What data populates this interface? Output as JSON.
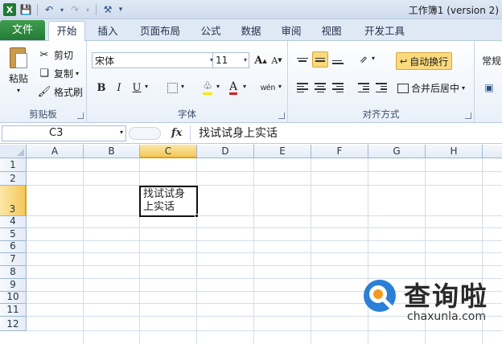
{
  "window": {
    "title": "工作簿1 (version 2)"
  },
  "quick_access": {
    "icons": [
      "excel-icon",
      "save-icon",
      "undo-icon",
      "redo-icon",
      "customize-icon"
    ]
  },
  "tabs": {
    "file": "文件",
    "items": [
      "开始",
      "插入",
      "页面布局",
      "公式",
      "数据",
      "审阅",
      "视图",
      "开发工具"
    ],
    "active": "开始"
  },
  "ribbon": {
    "clipboard": {
      "label": "剪贴板",
      "paste": "粘贴",
      "cut": "剪切",
      "copy": "复制",
      "format_painter": "格式刷"
    },
    "font": {
      "label": "字体",
      "font_name": "宋体",
      "font_size": "11",
      "bold": "B",
      "italic": "I",
      "underline": "U",
      "grow": "A",
      "shrink": "A",
      "phonetic": "wén"
    },
    "alignment": {
      "label": "对齐方式",
      "wrap_text": "自动换行",
      "merge_center": "合并后居中"
    },
    "number": {
      "format": "常规"
    }
  },
  "formula_bar": {
    "name_box": "C3",
    "fx": "fx",
    "content": "找试试身上实话"
  },
  "grid": {
    "columns": [
      "A",
      "B",
      "C",
      "D",
      "E",
      "F",
      "G",
      "H"
    ],
    "rows": [
      "1",
      "2",
      "3",
      "4",
      "5",
      "6",
      "7",
      "8",
      "9",
      "10",
      "11",
      "12"
    ],
    "selected_column": "C",
    "selected_row": "3",
    "active_cell": {
      "ref": "C3",
      "line1": "找试试身",
      "line2": "上实话"
    }
  },
  "watermark": {
    "brand": "查询啦",
    "url": "chaxunla.com"
  },
  "colors": {
    "file_tab": "#2e8b3f",
    "selection": "#f4c85b",
    "header_bg": "#e4ecf7",
    "gridline": "#d4dde8"
  }
}
